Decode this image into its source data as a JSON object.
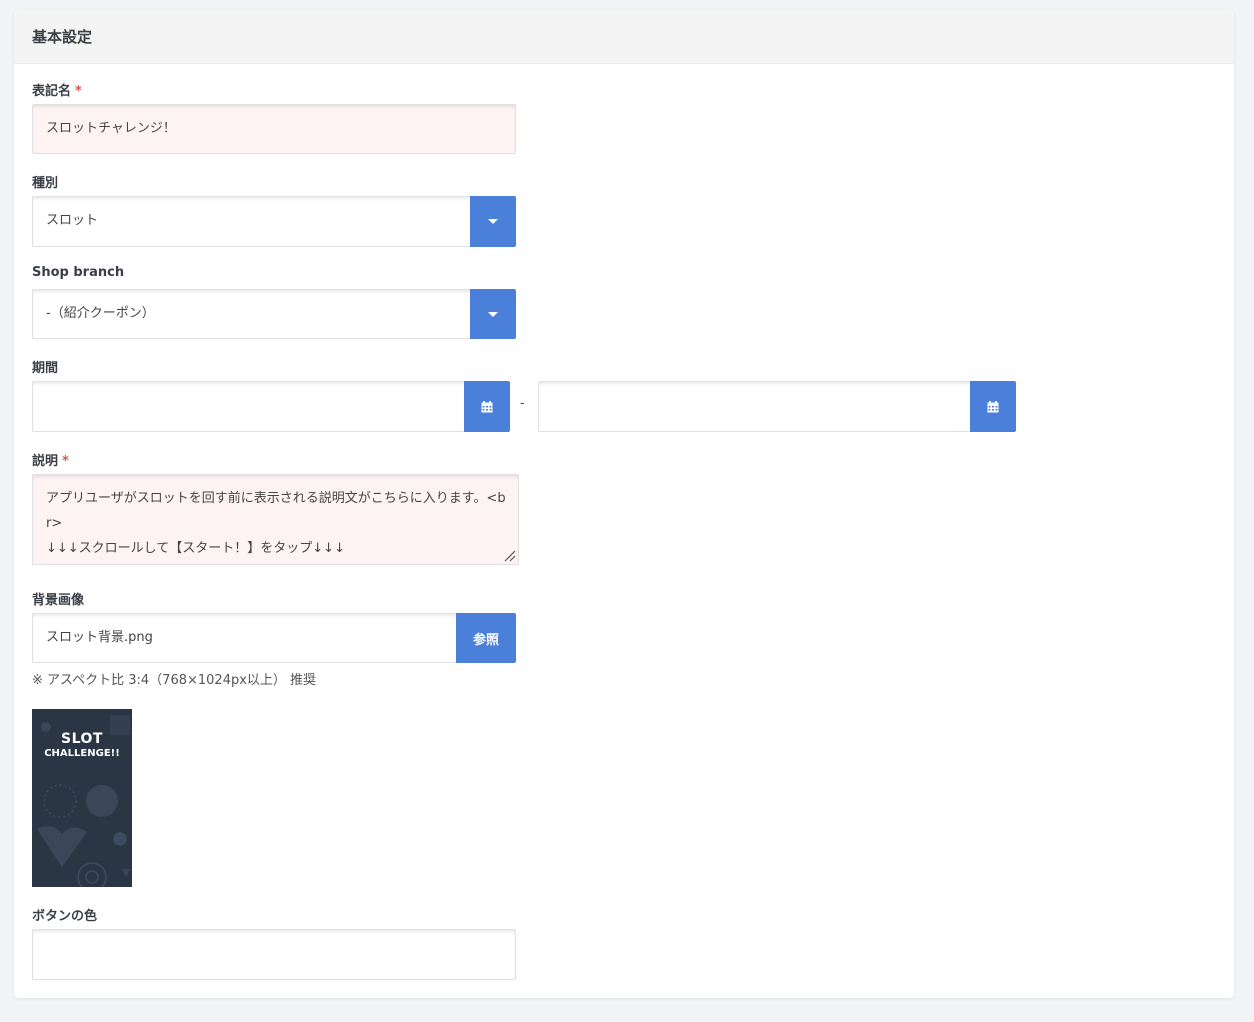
{
  "section": {
    "title": "基本設定"
  },
  "display_name": {
    "label": "表記名",
    "required_mark": "*",
    "value": "スロットチャレンジ！"
  },
  "type": {
    "label": "種別",
    "selected": "スロット"
  },
  "shop_branch": {
    "label": "Shop branch",
    "selected": "-（紹介クーポン）"
  },
  "period": {
    "label": "期間",
    "separator": "-",
    "start_value": "",
    "end_value": ""
  },
  "description": {
    "label": "説明",
    "required_mark": "*",
    "value": "アプリユーザがスロットを回す前に表示される説明文がこちらに入ります。<br>\n↓↓↓スクロールして【スタート！】をタップ↓↓↓"
  },
  "background_image": {
    "label": "背景画像",
    "file_name": "スロット背景.png",
    "browse_label": "参照",
    "note": "※ アスペクト比 3:4（768×1024px以上） 推奨",
    "preview": {
      "title_line1": "SLOT",
      "title_line2": "CHALLENGE!!"
    }
  },
  "button_color": {
    "label": "ボタンの色",
    "value": ""
  },
  "colors": {
    "accent": "#4a80d9",
    "error_bg": "#fdf3f3",
    "required": "#d9534f"
  }
}
